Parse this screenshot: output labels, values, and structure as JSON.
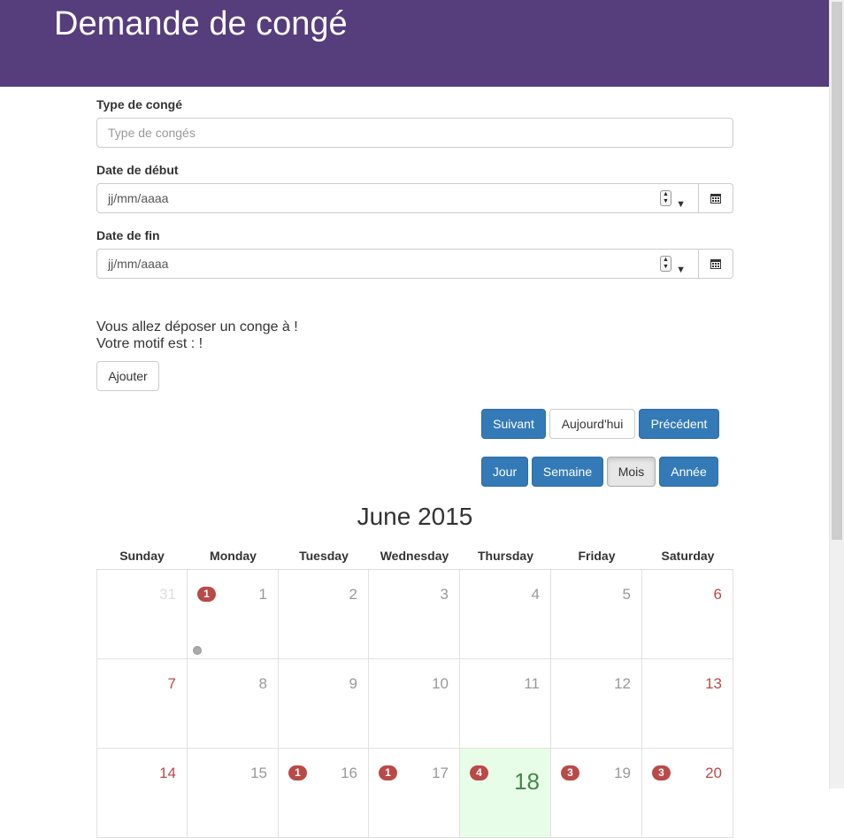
{
  "header": {
    "title": "Demande de congé",
    "bg_color": "#563d7c"
  },
  "form": {
    "type_label": "Type de congé",
    "type_placeholder": "Type de congés",
    "start_label": "Date de début",
    "start_value": "jj/mm/aaaa",
    "end_label": "Date de fin",
    "end_value": "jj/mm/aaaa",
    "message_line1": "Vous allez déposer un conge à !",
    "message_line2": "Votre motif est : !",
    "add_button": "Ajouter"
  },
  "calendar": {
    "nav": {
      "next": "Suivant",
      "today": "Aujourd'hui",
      "prev": "Précédent"
    },
    "views": {
      "day": "Jour",
      "week": "Semaine",
      "month": "Mois",
      "year": "Année",
      "active": "Mois"
    },
    "title": "June 2015",
    "weekdays": [
      "Sunday",
      "Monday",
      "Tuesday",
      "Wednesday",
      "Thursday",
      "Friday",
      "Saturday"
    ],
    "weeks": [
      [
        {
          "day": "31",
          "outside": true
        },
        {
          "day": "1",
          "badge": "1",
          "dot": true
        },
        {
          "day": "2"
        },
        {
          "day": "3"
        },
        {
          "day": "4"
        },
        {
          "day": "5"
        },
        {
          "day": "6"
        }
      ],
      [
        {
          "day": "7"
        },
        {
          "day": "8"
        },
        {
          "day": "9"
        },
        {
          "day": "10"
        },
        {
          "day": "11"
        },
        {
          "day": "12"
        },
        {
          "day": "13"
        }
      ],
      [
        {
          "day": "14"
        },
        {
          "day": "15"
        },
        {
          "day": "16",
          "badge": "1"
        },
        {
          "day": "17",
          "badge": "1"
        },
        {
          "day": "18",
          "badge": "4",
          "today": true
        },
        {
          "day": "19",
          "badge": "3"
        },
        {
          "day": "20",
          "badge": "3"
        }
      ]
    ],
    "colors": {
      "primary": "#337ab7",
      "badge": "#b94a48",
      "weekend": "#b94a48",
      "today_bg": "#e8fde7",
      "today_text": "#468847"
    }
  },
  "icons": {
    "calendar": "calendar-icon",
    "spinner": "spinner-icon",
    "dropdown": "dropdown-arrow-icon"
  }
}
